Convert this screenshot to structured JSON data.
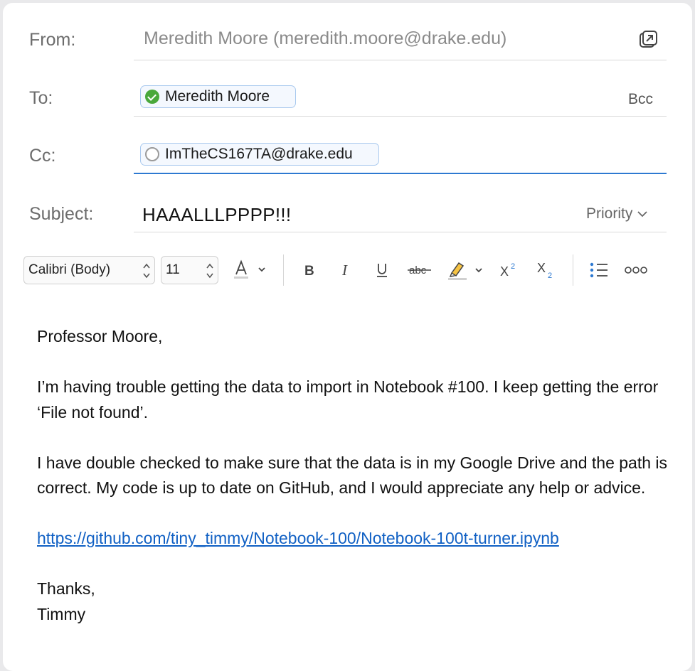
{
  "header": {
    "from_label": "From:",
    "from_value": "Meredith Moore (meredith.moore@drake.edu)",
    "to_label": "To:",
    "to_recipient": "Meredith Moore",
    "bcc_label": "Bcc",
    "cc_label": "Cc:",
    "cc_recipient": "ImTheCS167TA@drake.edu",
    "subject_label": "Subject:",
    "subject_value": "HAAALLLPPPP!!!",
    "priority_label": "Priority"
  },
  "toolbar": {
    "font_name": "Calibri (Body)",
    "font_size": "11"
  },
  "body": {
    "greeting": "Professor Moore,",
    "para1": "I’m having trouble getting the data to import in Notebook #100. I keep getting the error ‘File not found’.",
    "para2": "I have double checked to make sure that the data is in my Google Drive and the path is correct. My code is up to date on GitHub, and I would appreciate any help or advice.",
    "link": "https://github.com/tiny_timmy/Notebook-100/Notebook-100t-turner.ipynb",
    "closing": "Thanks,",
    "signature": "Timmy"
  },
  "colors": {
    "accent": "#2d79d1",
    "link": "#1060c4",
    "verified": "#4aa83b"
  }
}
